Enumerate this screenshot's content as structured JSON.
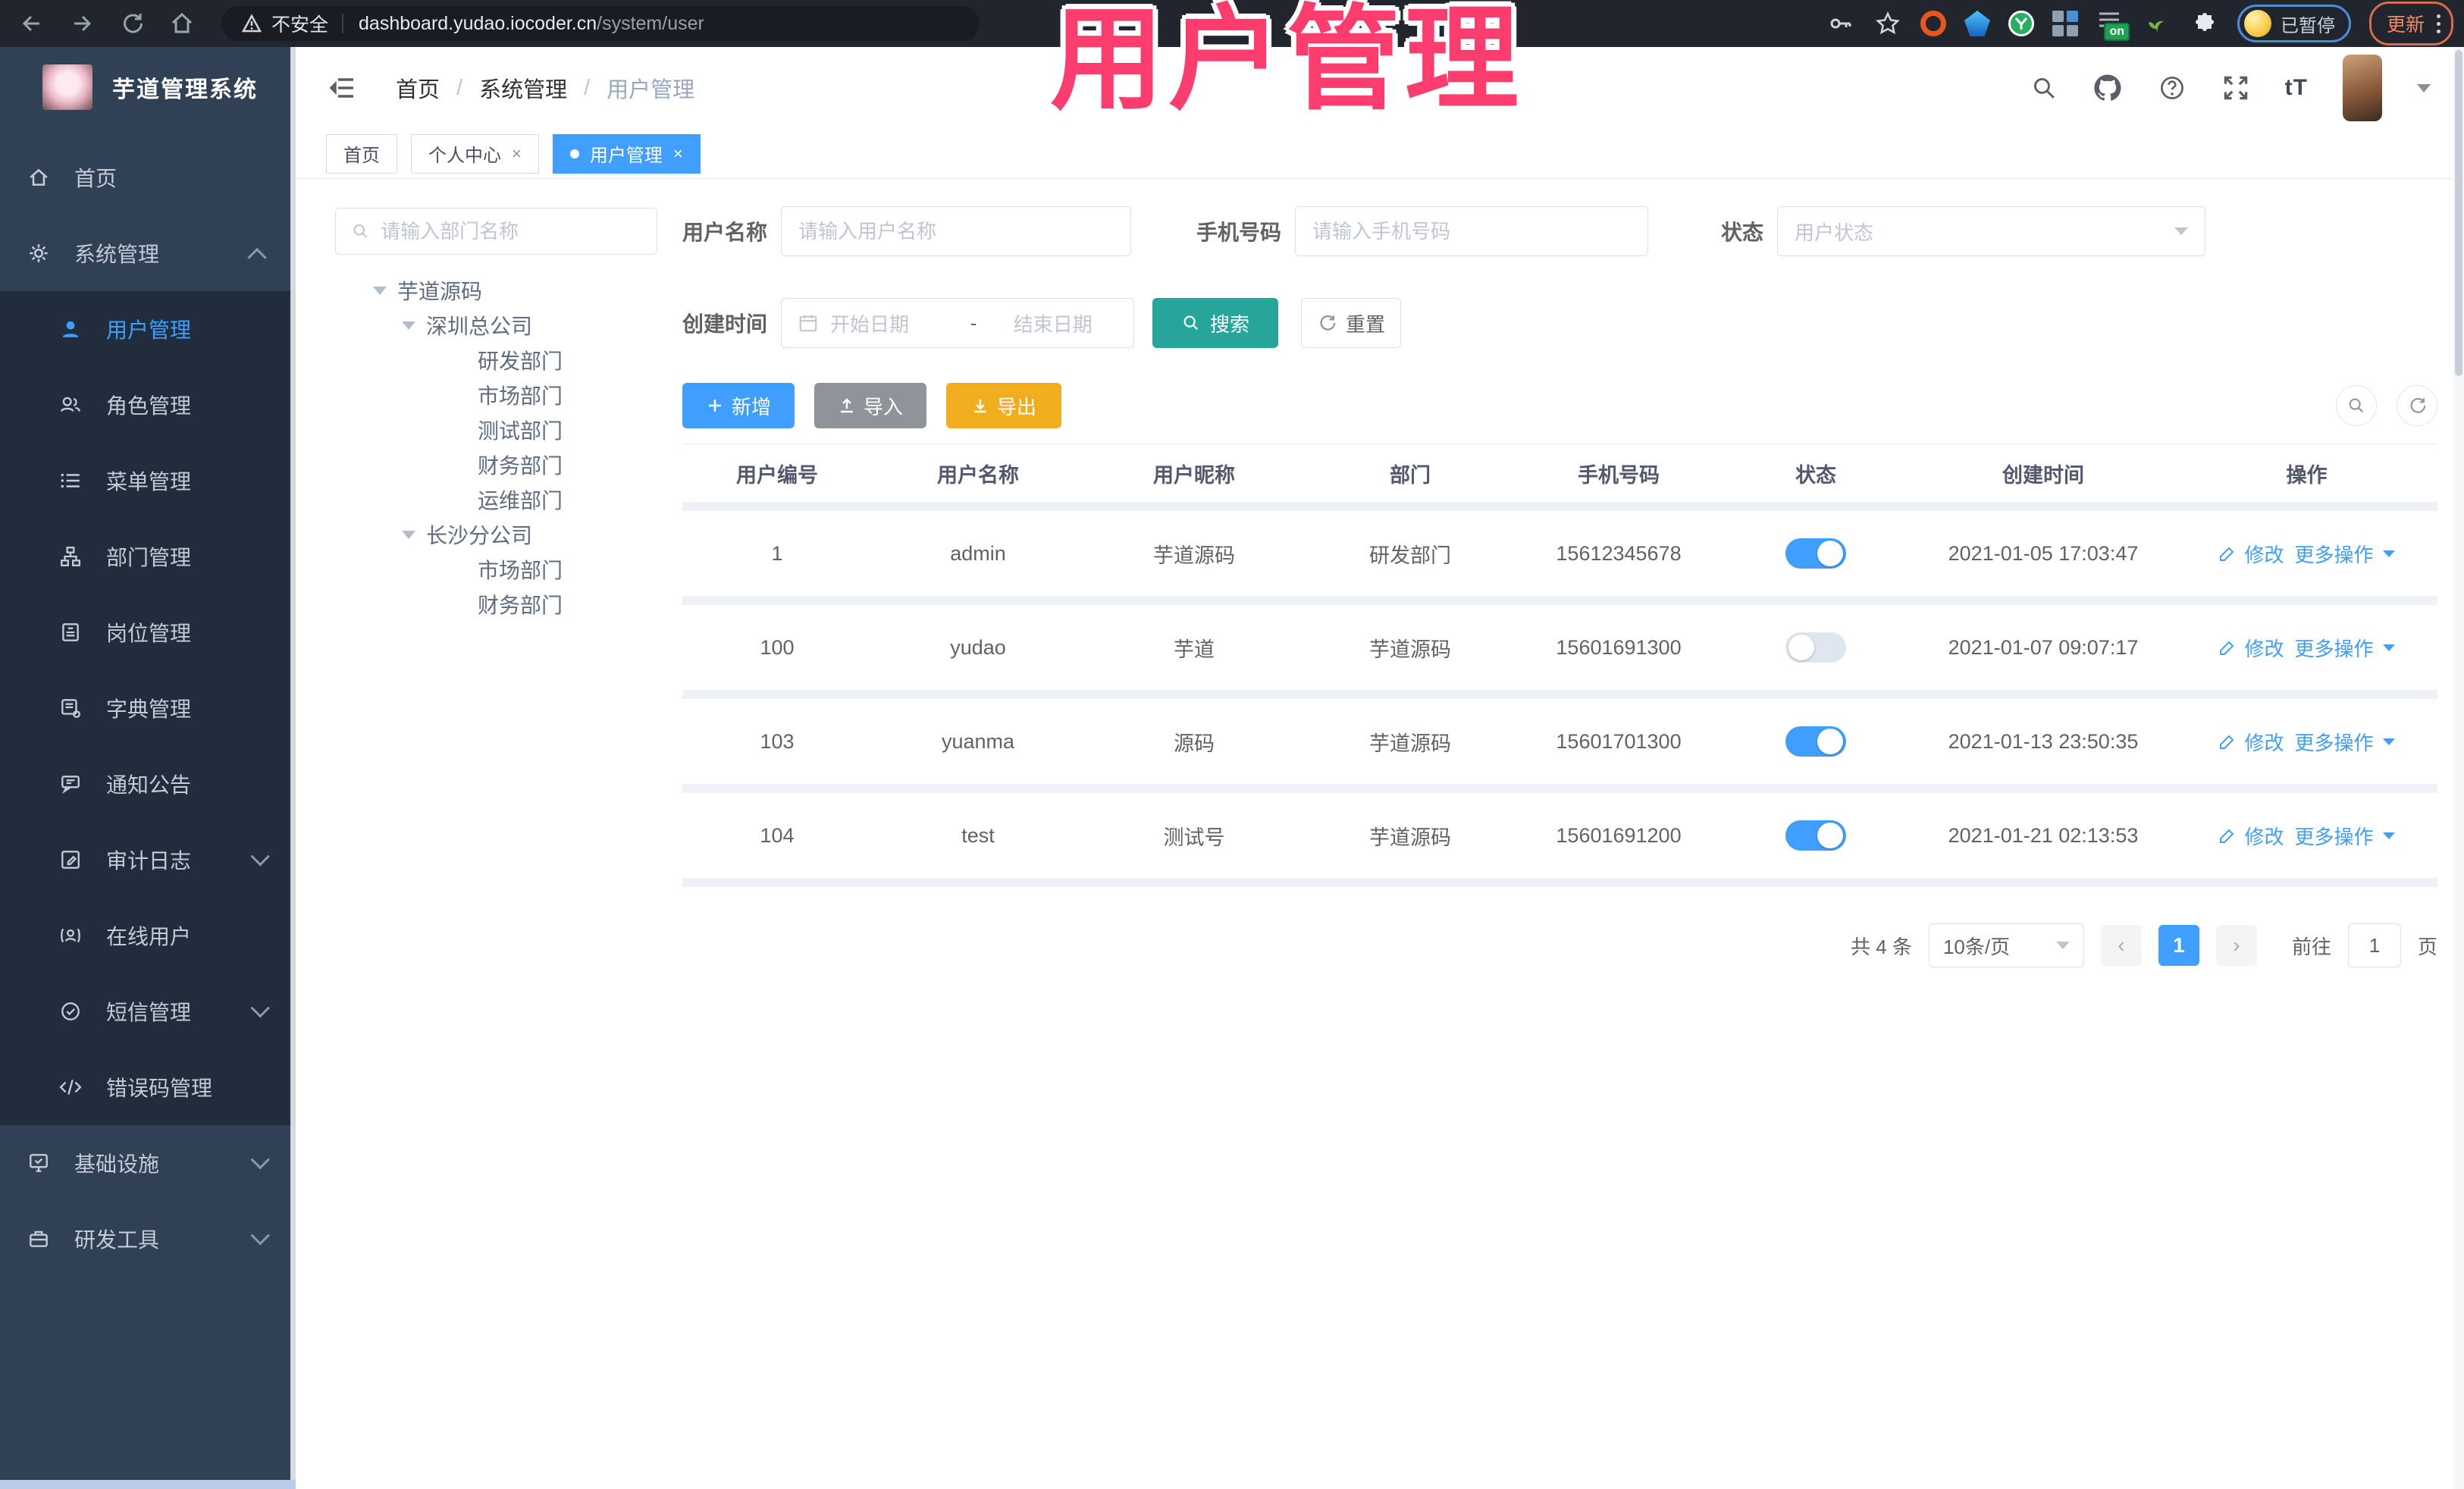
{
  "colors": {
    "accent": "#409eff",
    "teal": "#26a69a",
    "warning": "#f0ad1d",
    "pink": "#fb3d6e"
  },
  "browser": {
    "security_label": "不安全",
    "url_host": "dashboard.yudao.iocoder.cn",
    "url_path": "/system/user",
    "extension_on_badge": "on",
    "profile_status": "已暂停",
    "update_label": "更新"
  },
  "watermark": "用户管理",
  "sidebar": {
    "title": "芋道管理系统",
    "items": [
      {
        "label": "首页"
      },
      {
        "label": "系统管理"
      },
      {
        "label": "用户管理"
      },
      {
        "label": "角色管理"
      },
      {
        "label": "菜单管理"
      },
      {
        "label": "部门管理"
      },
      {
        "label": "岗位管理"
      },
      {
        "label": "字典管理"
      },
      {
        "label": "通知公告"
      },
      {
        "label": "审计日志"
      },
      {
        "label": "在线用户"
      },
      {
        "label": "短信管理"
      },
      {
        "label": "错误码管理"
      },
      {
        "label": "基础设施"
      },
      {
        "label": "研发工具"
      }
    ]
  },
  "header": {
    "breadcrumb": {
      "home": "首页",
      "section": "系统管理",
      "current": "用户管理",
      "separator": "/"
    },
    "font_icon_text": "tT"
  },
  "tags": {
    "home": "首页",
    "profile": "个人中心",
    "user": "用户管理"
  },
  "dept": {
    "search_placeholder": "请输入部门名称",
    "nodes": [
      {
        "label": "芋道源码"
      },
      {
        "label": "深圳总公司"
      },
      {
        "label": "研发部门"
      },
      {
        "label": "市场部门"
      },
      {
        "label": "测试部门"
      },
      {
        "label": "财务部门"
      },
      {
        "label": "运维部门"
      },
      {
        "label": "长沙分公司"
      },
      {
        "label": "市场部门"
      },
      {
        "label": "财务部门"
      }
    ]
  },
  "filters": {
    "username_label": "用户名称",
    "username_placeholder": "请输入用户名称",
    "mobile_label": "手机号码",
    "mobile_placeholder": "请输入手机号码",
    "status_label": "状态",
    "status_placeholder": "用户状态",
    "created_label": "创建时间",
    "date_start_placeholder": "开始日期",
    "date_separator": "-",
    "date_end_placeholder": "结束日期",
    "search_label": "搜索",
    "reset_label": "重置"
  },
  "toolbar": {
    "add": "新增",
    "import": "导入",
    "export": "导出"
  },
  "table": {
    "columns": [
      "用户编号",
      "用户名称",
      "用户昵称",
      "部门",
      "手机号码",
      "状态",
      "创建时间",
      "操作"
    ],
    "edit_label": "修改",
    "more_label": "更多操作",
    "rows": [
      {
        "id": "1",
        "username": "admin",
        "nickname": "芋道源码",
        "dept": "研发部门",
        "mobile": "15612345678",
        "status": true,
        "created": "2021-01-05 17:03:47"
      },
      {
        "id": "100",
        "username": "yudao",
        "nickname": "芋道",
        "dept": "芋道源码",
        "mobile": "15601691300",
        "status": false,
        "created": "2021-01-07 09:07:17"
      },
      {
        "id": "103",
        "username": "yuanma",
        "nickname": "源码",
        "dept": "芋道源码",
        "mobile": "15601701300",
        "status": true,
        "created": "2021-01-13 23:50:35"
      },
      {
        "id": "104",
        "username": "test",
        "nickname": "测试号",
        "dept": "芋道源码",
        "mobile": "15601691200",
        "status": true,
        "created": "2021-01-21 02:13:53"
      }
    ]
  },
  "pagination": {
    "total": "共 4 条",
    "page_size": "10条/页",
    "current": "1",
    "goto": "前往",
    "page_unit": "页"
  }
}
